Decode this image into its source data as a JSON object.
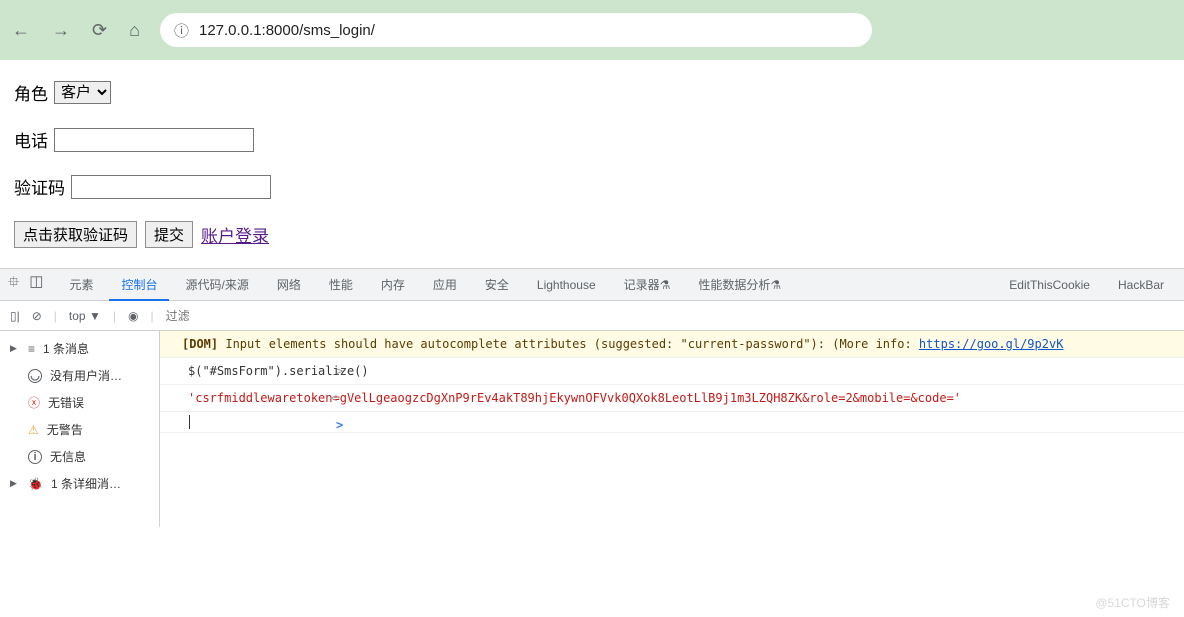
{
  "browser": {
    "url": "127.0.0.1:8000/sms_login/"
  },
  "form": {
    "role_label": "角色",
    "role_selected": "客户",
    "phone_label": "电话",
    "phone_value": "",
    "code_label": "验证码",
    "code_value": "",
    "get_code_btn": "点击获取验证码",
    "submit_btn": "提交",
    "account_login_link": "账户登录"
  },
  "devtools": {
    "tabs": {
      "elements": "元素",
      "console": "控制台",
      "sources": "源代码/来源",
      "network": "网络",
      "performance": "性能",
      "memory": "内存",
      "application": "应用",
      "security": "安全",
      "lighthouse": "Lighthouse",
      "recorder": "记录器",
      "perfanalysis": "性能数据分析",
      "editcookie": "EditThisCookie",
      "hackbar": "HackBar"
    },
    "toolbar": {
      "top": "top",
      "filter_placeholder": "过滤"
    },
    "sidebar": {
      "msgs": "1 条消息",
      "nouser": "没有用户消…",
      "noerr": "无错误",
      "nowarn": "无警告",
      "noinfo": "无信息",
      "verbose": "1 条详细消…"
    },
    "console": {
      "warn_prefix": "[DOM]",
      "warn_text": " Input elements should have autocomplete attributes (suggested: \"current-password\"): (More info: ",
      "warn_link": "https://goo.gl/9p2vK",
      "input1": "$(\"#SmsForm\").serialize()",
      "output1": "'csrfmiddlewaretoken=gVelLgeaogzcDgXnP9rEv4akT89hjEkywnOFVvk0QXok8LeotLlB9j1m3LZQH8ZK&role=2&mobile=&code='"
    }
  },
  "watermark": "@51CTO博客"
}
